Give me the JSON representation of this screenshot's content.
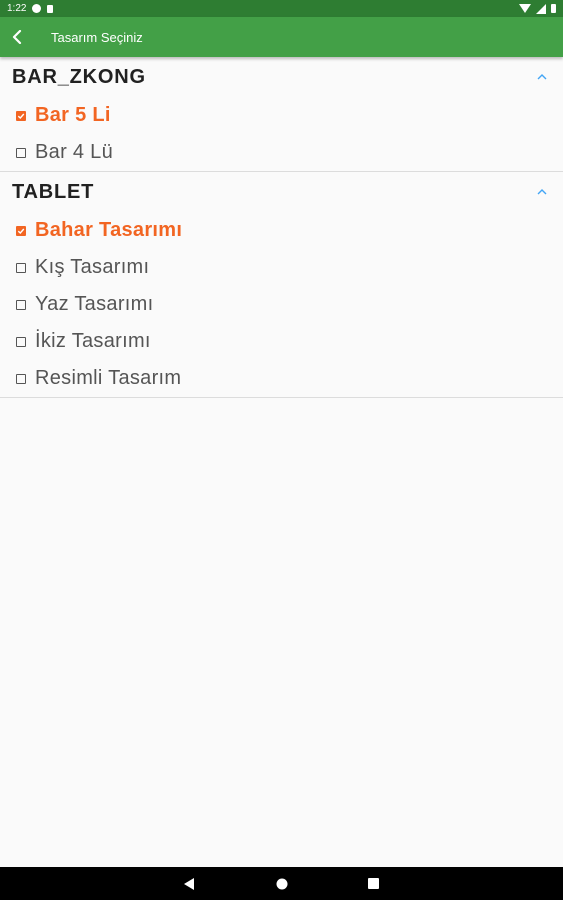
{
  "status_bar": {
    "time": "1:22"
  },
  "app_bar": {
    "title": "Tasarım Seçiniz"
  },
  "groups": [
    {
      "title": "BAR_ZKONG",
      "items": [
        {
          "label": "Bar 5 Li",
          "checked": true
        },
        {
          "label": "Bar 4 Lü",
          "checked": false
        }
      ]
    },
    {
      "title": "TABLET",
      "items": [
        {
          "label": "Bahar Tasarımı",
          "checked": true
        },
        {
          "label": "Kış Tasarımı",
          "checked": false
        },
        {
          "label": "Yaz Tasarımı",
          "checked": false
        },
        {
          "label": "İkiz Tasarımı",
          "checked": false
        },
        {
          "label": "Resimli Tasarım",
          "checked": false
        }
      ]
    }
  ],
  "colors": {
    "status_bar": "#2e7d32",
    "app_bar": "#43a047",
    "selected": "#f26522",
    "chevron": "#42a5f5"
  },
  "icons": {
    "back": "arrow-back-icon",
    "expand": "chevron-up-icon",
    "checkbox_checked": "checkbox-checked-icon",
    "checkbox_unchecked": "checkbox-unchecked-icon",
    "nav": [
      "back-triangle-icon",
      "home-circle-icon",
      "recents-square-icon"
    ]
  }
}
